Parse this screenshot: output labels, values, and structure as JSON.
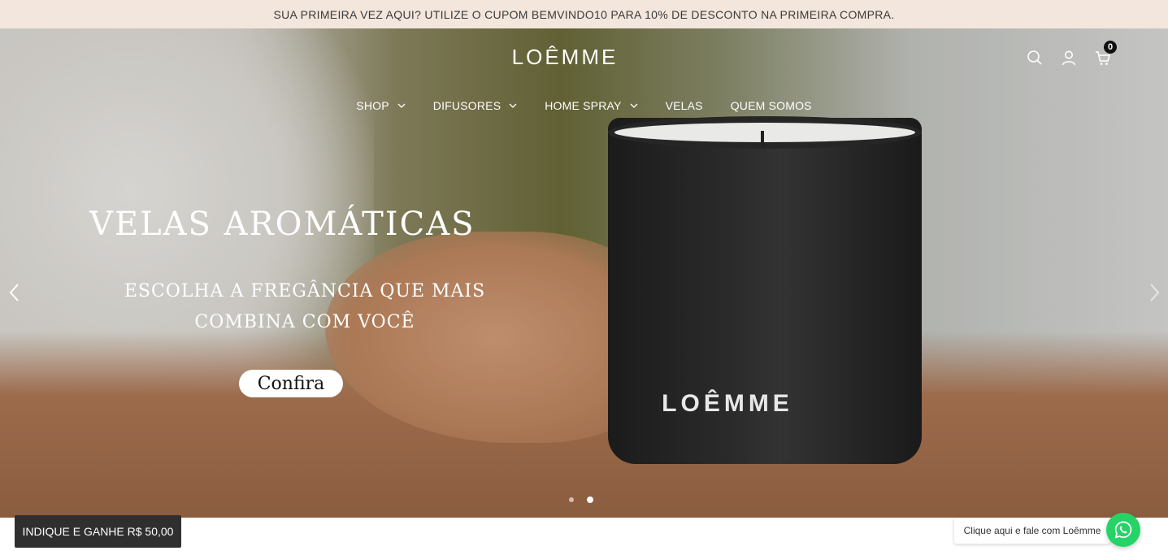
{
  "announcement": {
    "text": "SUA PRIMEIRA VEZ AQUI? UTILIZE O CUPOM BEMVINDO10 PARA 10% DE DESCONTO NA PRIMEIRA COMPRA."
  },
  "header": {
    "logo": "LOÊMME",
    "icons": {
      "search": "search-icon",
      "account": "user-icon",
      "cart": "cart-icon"
    },
    "cart_count": "0"
  },
  "nav": {
    "items": [
      {
        "label": "SHOP",
        "has_dropdown": true
      },
      {
        "label": "DIFUSORES",
        "has_dropdown": true
      },
      {
        "label": "HOME SPRAY",
        "has_dropdown": true
      },
      {
        "label": "VELAS",
        "has_dropdown": false
      },
      {
        "label": "QUEM SOMOS",
        "has_dropdown": false
      }
    ]
  },
  "hero": {
    "title": "VELAS AROMÁTICAS",
    "subtitle_line1": "ESCOLHA A FREGÂNCIA QUE MAIS",
    "subtitle_line2": "COMBINA COM VOCÊ",
    "cta": "Confira",
    "product_brand": "LOÊMME",
    "slides_total": 2,
    "active_slide": 2
  },
  "refer": {
    "label": "INDIQUE E GANHE R$ 50,00"
  },
  "whatsapp": {
    "tooltip": "Clique aqui e fale com Loêmme",
    "color": "#25d366"
  },
  "colors": {
    "announcement_bg": "#f3e6dc",
    "refer_bg": "#2f2f2f"
  }
}
